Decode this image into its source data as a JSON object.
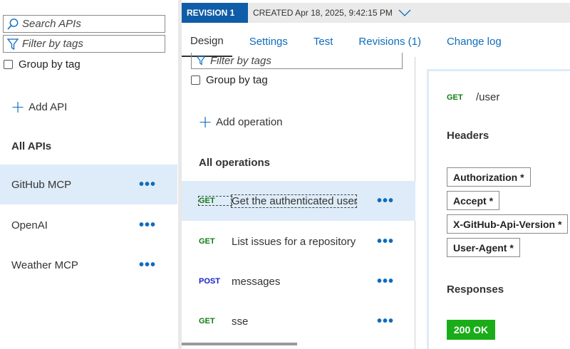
{
  "left_panel": {
    "search_placeholder": "Search APIs",
    "filter_placeholder": "Filter by tags",
    "group_by_tag": "Group by tag",
    "add_api": "Add API",
    "all_apis": "All APIs",
    "apis": [
      {
        "name": "GitHub MCP",
        "selected": true
      },
      {
        "name": "OpenAI",
        "selected": false
      },
      {
        "name": "Weather MCP",
        "selected": false
      }
    ],
    "more_label": "•••"
  },
  "revision": {
    "badge": "REVISION 1",
    "created": "CREATED Apr 18, 2025, 9:42:15 PM"
  },
  "tabs": [
    {
      "label": "Design",
      "active": true
    },
    {
      "label": "Settings",
      "active": false
    },
    {
      "label": "Test",
      "active": false
    },
    {
      "label": "Revisions (1)",
      "active": false
    },
    {
      "label": "Change log",
      "active": false
    }
  ],
  "operations_panel": {
    "filter_placeholder": "Filter by tags",
    "group_by_tag": "Group by tag",
    "add_operation": "Add operation",
    "all_operations": "All operations",
    "operations": [
      {
        "method": "GET",
        "name": "Get the authenticated user",
        "selected": true
      },
      {
        "method": "GET",
        "name": "List issues for a repository",
        "selected": false
      },
      {
        "method": "POST",
        "name": "messages",
        "selected": false
      },
      {
        "method": "GET",
        "name": "sse",
        "selected": false
      }
    ]
  },
  "detail": {
    "method": "GET",
    "path": "/user",
    "headers_title": "Headers",
    "headers": [
      "Authorization *",
      "Accept *",
      "X-GitHub-Api-Version *",
      "User-Agent *"
    ],
    "responses_title": "Responses",
    "response_badge": "200 OK"
  },
  "colors": {
    "accent": "#0f6cbd",
    "revision_badge": "#0f5ca8",
    "selected_row": "#deecf9",
    "get_method": "#107c10",
    "post_method": "#1120c8",
    "ok_badge": "#1aad19"
  },
  "icons": {
    "search": "search-icon",
    "filter": "filter-icon",
    "plus": "plus-icon",
    "chevron": "chevron-down-icon"
  }
}
